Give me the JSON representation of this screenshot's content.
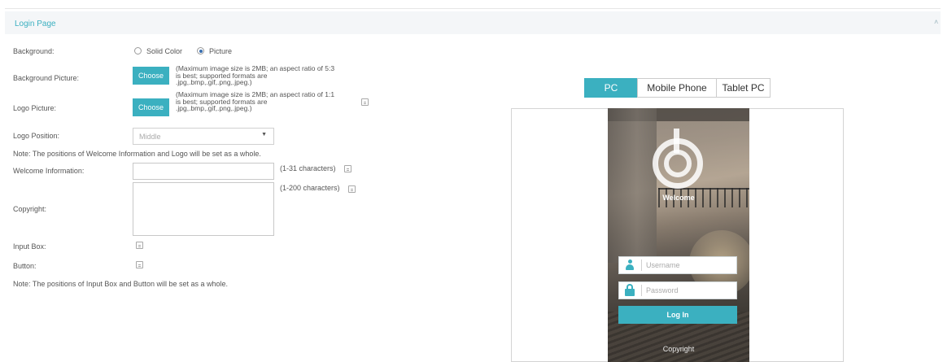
{
  "section": {
    "title": "Login Page"
  },
  "form": {
    "background": {
      "label": "Background:",
      "options": [
        "Solid Color",
        "Picture"
      ],
      "selected": "Picture"
    },
    "background_picture": {
      "label": "Background Picture:",
      "button": "Choose",
      "hint_lines": [
        "(Maximum image size is 2MB; an aspect ratio of 5:3",
        "is best; supported formats are",
        ".jpg,.bmp,.gif,.png,.jpeg.)"
      ]
    },
    "logo_picture": {
      "label": "Logo Picture:",
      "button": "Choose",
      "hint_lines": [
        "(Maximum image size is 2MB; an aspect ratio of 1:1",
        "is best; supported formats are",
        ".jpg,.bmp,.gif,.png,.jpeg.)"
      ]
    },
    "logo_position": {
      "label": "Logo Position:",
      "value": "Middle"
    },
    "note_welcome_logo": "Note: The positions of Welcome Information and Logo will be set as a whole.",
    "welcome_information": {
      "label": "Welcome Information:",
      "value": "",
      "range": "(1-31 characters)"
    },
    "copyright": {
      "label": "Copyright:",
      "value": "",
      "range": "(1-200 characters)"
    },
    "input_box": {
      "label": "Input Box:"
    },
    "button": {
      "label": "Button:"
    },
    "note_input_button": "Note: The positions of Input Box and Button will be set as a whole."
  },
  "preview": {
    "tabs": [
      {
        "label": "PC",
        "active": true
      },
      {
        "label": "Mobile Phone",
        "active": false
      },
      {
        "label": "Tablet PC",
        "active": false
      }
    ],
    "welcome": "Welcome",
    "username_placeholder": "Username",
    "password_placeholder": "Password",
    "login_button": "Log In",
    "copyright": "Copyright"
  },
  "colors": {
    "accent": "#3bb0c0",
    "title": "#3bb0c0",
    "text": "#555555",
    "border": "#cccccc"
  },
  "icons": [
    "collapse-icon",
    "info-icon",
    "chevron-down-icon",
    "user-icon",
    "lock-icon",
    "logo-icon"
  ]
}
